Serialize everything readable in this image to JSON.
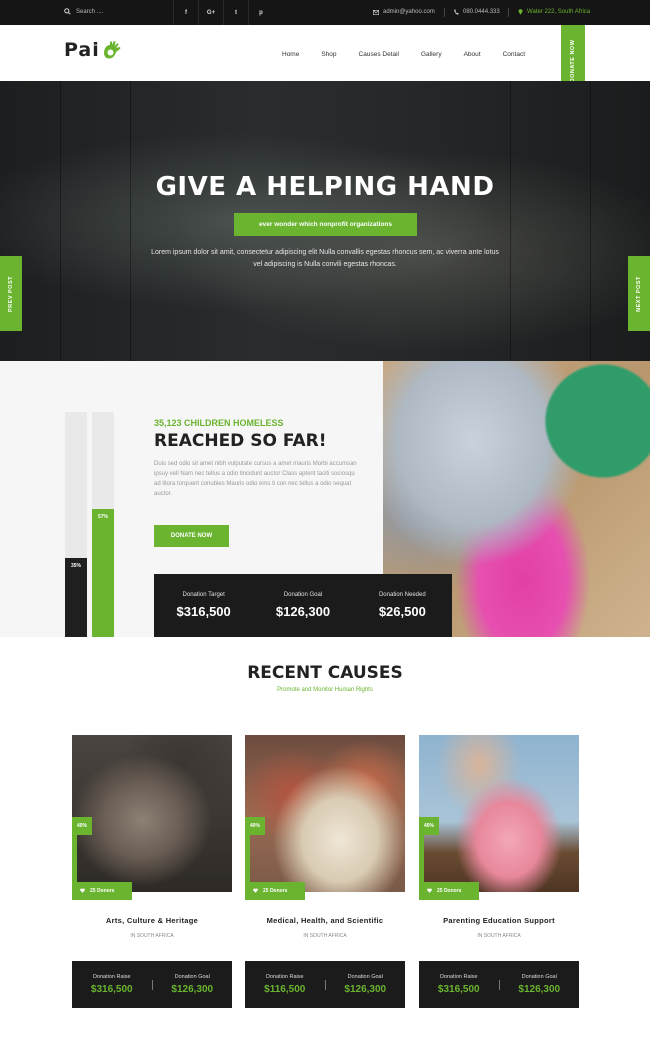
{
  "topbar": {
    "search_placeholder": "Search ....",
    "social": [
      {
        "label": "f",
        "icon": "facebook-icon"
      },
      {
        "label": "G+",
        "icon": "google-plus-icon"
      },
      {
        "label": "t",
        "icon": "twitter-icon"
      },
      {
        "label": "p",
        "icon": "pinterest-icon"
      }
    ],
    "email": "admin@yahoo.com",
    "phone": "080.0444.333",
    "address": "Water 222, South Africa"
  },
  "header": {
    "logo_text": "Pai",
    "nav": [
      "Home",
      "Shop",
      "Causes Detail",
      "Gallery",
      "About",
      "Contact"
    ],
    "donate_tab": "DONATE NOW"
  },
  "hero": {
    "title": "GIVE A HELPING HAND",
    "pill": "ever wonder which nonprofit organizations",
    "description": "Lorem ipsum dolor sit amit, consectetur adipiscing elit Nulla convallis egestas rhoncus sem, ac viverra ante lotus vel adipiscing is Nulla convili egestas rhoncas.",
    "prev": "PREV POST",
    "next": "NEXT POST"
  },
  "reach": {
    "kicker": "35,123 CHILDREN HOMELESS",
    "title": "REACHED SO FAR!",
    "paragraph": "Duis sed odio sit amet nibh vulputate cursus a amet mauris Morbi accumsan ipsuy vell Nam nec tellus a odio tincidunt auctor Class aptent taciti sociosqu ad litora torquent conubies Mauris odio ems ti con nec tellus a odio sequat auctor.",
    "button": "DONATE NOW",
    "bars": [
      {
        "label": "35%",
        "value": 0.35,
        "color": "#1f1f1f"
      },
      {
        "label": "57%",
        "value": 0.57,
        "color": "#6ab42f"
      }
    ],
    "stats": [
      {
        "label": "Donation Target",
        "value": "$316,500"
      },
      {
        "label": "Donation Goal",
        "value": "$126,300"
      },
      {
        "label": "Donation Needed",
        "value": "$26,500"
      }
    ]
  },
  "causes": {
    "title": "RECENT CAUSES",
    "subtitle": "Promote and Monitor Human Rights",
    "cards": [
      {
        "percent": "40%",
        "donors": "25 Donors",
        "title": "Arts, Culture & Heritage",
        "location": "IN SOUTH AFRICA",
        "raise_label": "Donation Raise",
        "raise": "$316,500",
        "goal_label": "Donation Goal",
        "goal": "$126,300"
      },
      {
        "percent": "40%",
        "donors": "25 Donors",
        "title": "Medical, Health, and Scientific",
        "location": "IN SOUTH AFRICA",
        "raise_label": "Donation Raise",
        "raise": "$116,500",
        "goal_label": "Donation Goal",
        "goal": "$126,300"
      },
      {
        "percent": "40%",
        "donors": "25 Donors",
        "title": "Parenting Education Support",
        "location": "IN SOUTH AFRICA",
        "raise_label": "Donation Raise",
        "raise": "$316,500",
        "goal_label": "Donation Goal",
        "goal": "$126,300"
      }
    ]
  },
  "colors": {
    "accent": "#6ab42f",
    "dark": "#1b1b1b"
  }
}
